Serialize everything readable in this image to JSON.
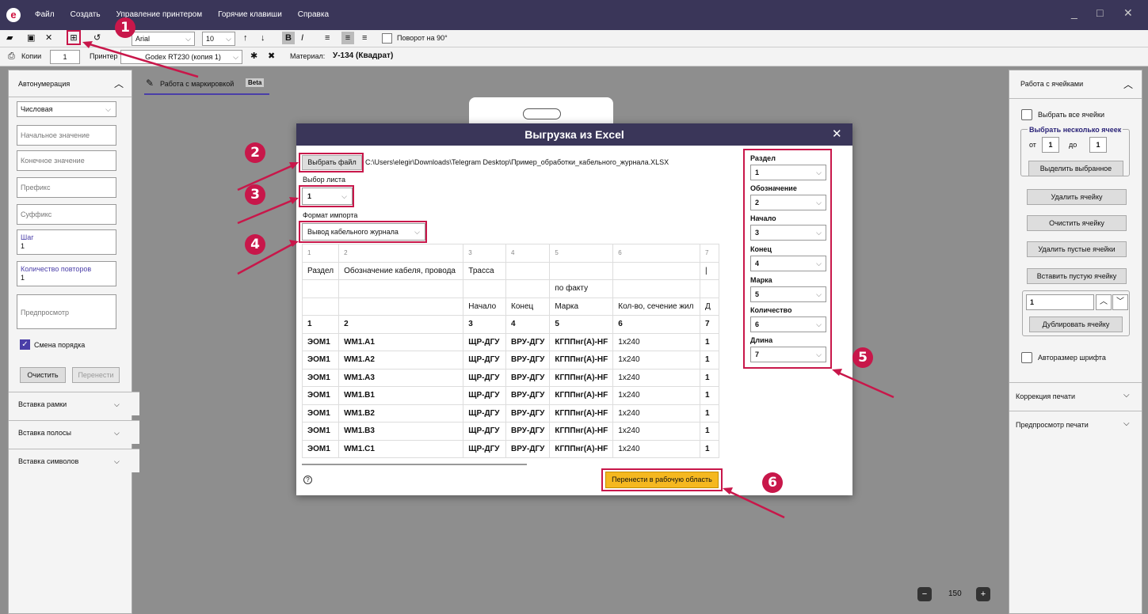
{
  "menu": [
    "Файл",
    "Создать",
    "Управление принтером",
    "Горячие клавиши",
    "Справка"
  ],
  "window_controls": [
    "_",
    "□",
    "✕"
  ],
  "toolbar": {
    "font": "Arial",
    "size": "10",
    "rotate_label": "Поворот на 90°",
    "copies_label": "Копии",
    "copies_value": "1",
    "printer_label": "Принтер",
    "printer_value": "Godex RT230 (копия 1)",
    "material_label": "Материал:",
    "material_value": "У-134 (Квадрат)"
  },
  "left_panel": {
    "title": "Автонумерация",
    "type": "Числовая",
    "start_ph": "Начальное значение",
    "end_ph": "Конечное значение",
    "prefix_ph": "Префикс",
    "suffix_ph": "Суффикс",
    "step_label": "Шаг",
    "step_value": "1",
    "repeat_label": "Количество повторов",
    "repeat_value": "1",
    "preview_ph": "Предпросмотр",
    "order_label": "Смена порядка",
    "clear_btn": "Очистить",
    "move_btn": "Перенести",
    "sections": [
      "Вставка рамки",
      "Вставка полосы",
      "Вставка символов"
    ]
  },
  "workspace": {
    "tab_label": "Работа с маркировкой",
    "beta": "Beta",
    "zoom": "150"
  },
  "dialog": {
    "title": "Выгрузка из Excel",
    "choose_file": "Выбрать файл",
    "file_path": "C:\\Users\\elegir\\Downloads\\Telegram Desktop\\Пример_обработки_кабельного_журнала.XLSX",
    "sheet_label": "Выбор листа",
    "sheet_value": "1",
    "format_label": "Формат импорта",
    "format_value": "Вывод кабельного журнала",
    "transfer_btn": "Перенести в рабочую область",
    "help_icon": "?",
    "table_header": [
      "1",
      "2",
      "3",
      "4",
      "5",
      "6",
      "7"
    ],
    "rows": [
      [
        "Раздел",
        "Обозначение кабеля, провода",
        "Трасса",
        "",
        "",
        "",
        "|"
      ],
      [
        "",
        "",
        "",
        "",
        "по факту",
        "",
        ""
      ],
      [
        "",
        "",
        "Начало",
        "Конец",
        "Марка",
        "Кол-во, сечение жил",
        "Д"
      ],
      [
        "1",
        "2",
        "3",
        "4",
        "5",
        "6",
        "7"
      ],
      [
        "ЭОМ1",
        "WM1.A1",
        "ЩР-ДГУ",
        "ВРУ-ДГУ",
        "КГППнг(А)-HF",
        "1х240",
        "1"
      ],
      [
        "ЭОМ1",
        "WM1.A2",
        "ЩР-ДГУ",
        "ВРУ-ДГУ",
        "КГППнг(А)-HF",
        "1х240",
        "1"
      ],
      [
        "ЭОМ1",
        "WM1.A3",
        "ЩР-ДГУ",
        "ВРУ-ДГУ",
        "КГППнг(А)-HF",
        "1х240",
        "1"
      ],
      [
        "ЭОМ1",
        "WM1.B1",
        "ЩР-ДГУ",
        "ВРУ-ДГУ",
        "КГППнг(А)-HF",
        "1х240",
        "1"
      ],
      [
        "ЭОМ1",
        "WM1.B2",
        "ЩР-ДГУ",
        "ВРУ-ДГУ",
        "КГППнг(А)-HF",
        "1х240",
        "1"
      ],
      [
        "ЭОМ1",
        "WM1.B3",
        "ЩР-ДГУ",
        "ВРУ-ДГУ",
        "КГППнг(А)-HF",
        "1х240",
        "1"
      ],
      [
        "ЭОМ1",
        "WM1.C1",
        "ЩР-ДГУ",
        "ВРУ-ДГУ",
        "КГППнг(А)-HF",
        "1х240",
        "1"
      ]
    ],
    "mapping": [
      {
        "label": "Раздел",
        "value": "1"
      },
      {
        "label": "Обозначение",
        "value": "2"
      },
      {
        "label": "Начало",
        "value": "3"
      },
      {
        "label": "Конец",
        "value": "4"
      },
      {
        "label": "Марка",
        "value": "5"
      },
      {
        "label": "Количество",
        "value": "6"
      },
      {
        "label": "Длина",
        "value": "7"
      }
    ]
  },
  "right_panel": {
    "title": "Работа с ячейками",
    "select_all": "Выбрать все ячейки",
    "select_some": "Выбрать несколько ячеек",
    "from_label": "от",
    "from_value": "1",
    "to_label": "до",
    "to_value": "1",
    "highlight_btn": "Выделить выбранное",
    "delete_cell": "Удалить ячейку",
    "clear_cell": "Очистить ячейку",
    "delete_empty": "Удалить пустые ячейки",
    "insert_empty": "Вставить пустую ячейку",
    "dup_value": "1",
    "dup_btn": "Дублировать ячейку",
    "autosize": "Авторазмер шрифта",
    "correction": "Коррекция печати",
    "preview": "Предпросмотр печати"
  },
  "badges": [
    "1",
    "2",
    "3",
    "4",
    "5",
    "6"
  ],
  "colors": {
    "accent": "#c8174a",
    "header": "#3a3659",
    "transfer": "#f5b820"
  }
}
